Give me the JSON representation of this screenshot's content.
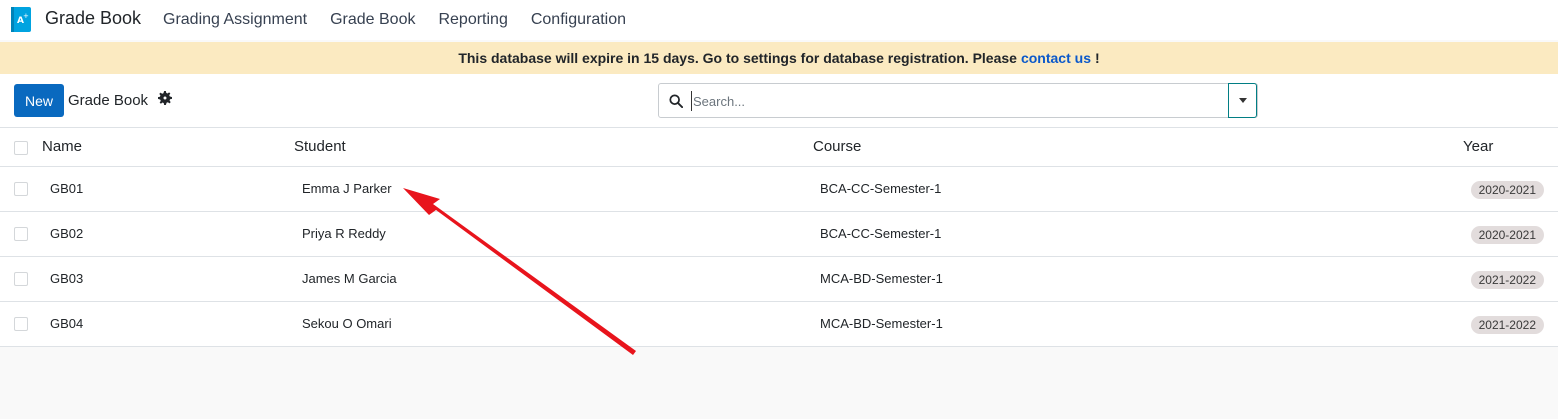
{
  "navbar": {
    "app_name": "Grade Book",
    "app_icon": "grade-book-app-icon",
    "menu": [
      {
        "label": "Grading Assignment"
      },
      {
        "label": "Grade Book"
      },
      {
        "label": "Reporting"
      },
      {
        "label": "Configuration"
      }
    ]
  },
  "banner": {
    "text": "This database will expire in 15 days. Go to settings for database registration. Please",
    "link": "contact us",
    "suffix": "!"
  },
  "control": {
    "new_label": "New",
    "breadcrumb": "Grade Book",
    "gear_icon": "gear-icon"
  },
  "search": {
    "placeholder": "Search...",
    "icon": "search-icon",
    "toggle_icon": "caret-down-icon"
  },
  "table": {
    "headers": {
      "name": "Name",
      "student": "Student",
      "course": "Course",
      "year": "Year"
    },
    "rows": [
      {
        "name": "GB01",
        "student": "Emma J Parker",
        "course": "BCA-CC-Semester-1",
        "year": "2020-2021"
      },
      {
        "name": "GB02",
        "student": "Priya R Reddy",
        "course": "BCA-CC-Semester-1",
        "year": "2020-2021"
      },
      {
        "name": "GB03",
        "student": "James M Garcia",
        "course": "MCA-BD-Semester-1",
        "year": "2021-2022"
      },
      {
        "name": "GB04",
        "student": "Sekou O Omari",
        "course": "MCA-BD-Semester-1",
        "year": "2021-2022"
      }
    ]
  },
  "colors": {
    "primary": "#0969bf",
    "banner_bg": "#fbeac1",
    "link": "#0a58ca",
    "annotation_arrow": "#e8141c"
  }
}
